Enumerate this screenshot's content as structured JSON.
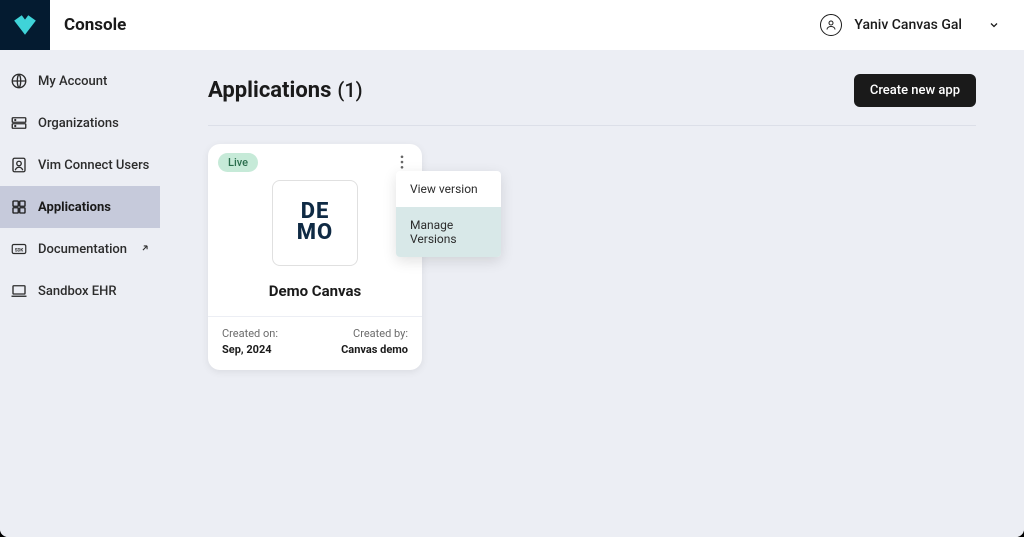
{
  "header": {
    "product": "Console",
    "user_name": "Yaniv Canvas Gal"
  },
  "sidebar": {
    "items": [
      {
        "label": "My Account"
      },
      {
        "label": "Organizations"
      },
      {
        "label": "Vim Connect Users"
      },
      {
        "label": "Applications"
      },
      {
        "label": "Documentation"
      },
      {
        "label": "Sandbox EHR"
      }
    ]
  },
  "page": {
    "title": "Applications",
    "count": "(1)",
    "create_label": "Create new app"
  },
  "app_card": {
    "status": "Live",
    "logo_text": "DE\nMO",
    "name": "Demo Canvas",
    "created_on_label": "Created on:",
    "created_on_value": "Sep, 2024",
    "created_by_label": "Created by:",
    "created_by_value": "Canvas demo"
  },
  "dropdown": {
    "view_version": "View version",
    "manage_versions": "Manage Versions"
  }
}
